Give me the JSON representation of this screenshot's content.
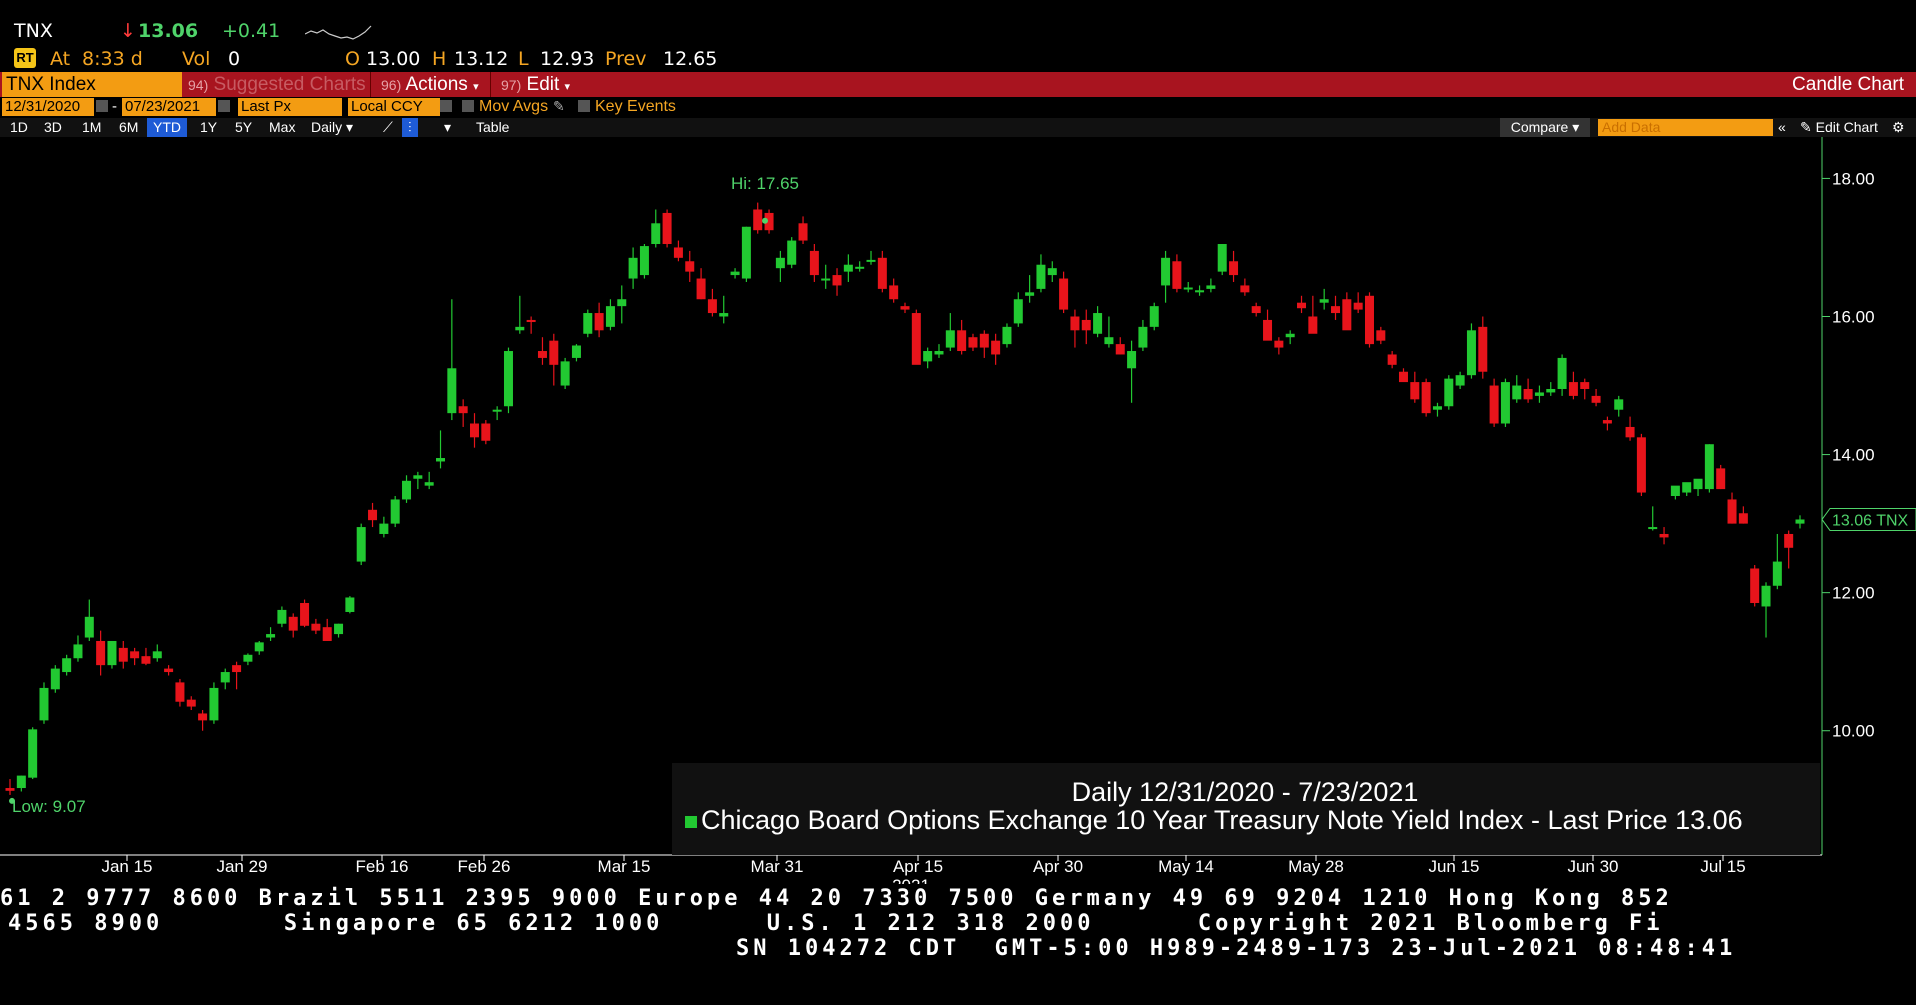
{
  "quote": {
    "ticker": "TNX",
    "arrow": "↓",
    "last": "13.06",
    "change": "+0.41",
    "at_label": "At",
    "time": "8:33 d",
    "vol_label": "Vol",
    "vol": "0",
    "open_label": "O",
    "open": "13.00",
    "high_label": "H",
    "high": "13.12",
    "low_label": "L",
    "low": "12.93",
    "prev_label": "Prev",
    "prev": "12.65"
  },
  "toolbar": {
    "security": "TNX Index",
    "suggest_num": "94)",
    "suggest_label": "Suggested Charts",
    "actions_num": "96)",
    "actions_label": "Actions",
    "edit_num": "97)",
    "edit_label": "Edit",
    "chart_type": "Candle Chart"
  },
  "fields": {
    "start_date": "12/31/2020",
    "dash": "-",
    "end_date": "07/23/2021",
    "price_field": "Last Px",
    "currency": "Local CCY",
    "mov_avgs": "Mov Avgs",
    "key_events": "Key Events"
  },
  "periods": [
    "1D",
    "3D",
    "1M",
    "6M",
    "YTD",
    "1Y",
    "5Y",
    "Max"
  ],
  "selected_period": "YTD",
  "frequency": "Daily",
  "table_label": "Table",
  "compare_label": "Compare",
  "add_data_placeholder": "Add Data",
  "edit_chart_label": "Edit Chart",
  "colors": {
    "up": "#22c932",
    "down": "#e8141b",
    "axis": "#4fd36a",
    "accent": "#f39c12",
    "toolbar": "#a8141f"
  },
  "chart_data": {
    "type": "candlestick",
    "ylim": [
      8.2,
      18.6
    ],
    "yticks": [
      "18.00",
      "16.00",
      "14.00",
      "12.00",
      "10.00"
    ],
    "xticks": [
      "Jan 15",
      "Jan 29",
      "Feb 16",
      "Feb 26",
      "Mar 15",
      "Mar 31",
      "Apr 15",
      "Apr 30",
      "May 14",
      "May 28",
      "Jun 15",
      "Jun 30",
      "Jul 15"
    ],
    "year_label": "2021",
    "hi_label": "Hi: 17.65",
    "low_label": "Low: 9.07",
    "last_label": "13.06 TNX",
    "legend_title": "Daily 12/31/2020 - 7/23/2021",
    "legend_series": "Chicago Board Options Exchange 10 Year Treasury Note Yield Index - Last Price 13.06",
    "candles": [
      [
        9.17,
        9.3,
        9.07,
        9.13
      ],
      [
        9.17,
        9.35,
        9.12,
        9.35
      ],
      [
        9.32,
        10.05,
        9.3,
        10.02
      ],
      [
        10.15,
        10.7,
        10.1,
        10.62
      ],
      [
        10.6,
        10.95,
        10.55,
        10.9
      ],
      [
        10.85,
        11.1,
        10.8,
        11.05
      ],
      [
        11.05,
        11.38,
        11.0,
        11.25
      ],
      [
        11.35,
        11.9,
        11.3,
        11.65
      ],
      [
        11.3,
        11.45,
        10.8,
        10.95
      ],
      [
        10.95,
        11.3,
        10.9,
        11.3
      ],
      [
        11.2,
        11.3,
        10.9,
        11.0
      ],
      [
        11.15,
        11.2,
        10.95,
        11.05
      ],
      [
        11.08,
        11.2,
        10.95,
        10.97
      ],
      [
        11.05,
        11.25,
        11.0,
        11.15
      ],
      [
        10.9,
        10.95,
        10.8,
        10.85
      ],
      [
        10.7,
        10.75,
        10.35,
        10.42
      ],
      [
        10.45,
        10.5,
        10.3,
        10.35
      ],
      [
        10.25,
        10.3,
        10.0,
        10.15
      ],
      [
        10.15,
        10.7,
        10.1,
        10.62
      ],
      [
        10.7,
        10.9,
        10.6,
        10.85
      ],
      [
        10.95,
        11.0,
        10.6,
        10.85
      ],
      [
        11.0,
        11.12,
        10.95,
        11.1
      ],
      [
        11.15,
        11.3,
        11.1,
        11.28
      ],
      [
        11.35,
        11.5,
        11.3,
        11.4
      ],
      [
        11.55,
        11.8,
        11.5,
        11.75
      ],
      [
        11.65,
        11.7,
        11.35,
        11.45
      ],
      [
        11.85,
        11.9,
        11.5,
        11.52
      ],
      [
        11.55,
        11.62,
        11.4,
        11.45
      ],
      [
        11.5,
        11.62,
        11.3,
        11.3
      ],
      [
        11.4,
        11.55,
        11.35,
        11.55
      ],
      [
        11.72,
        11.95,
        11.7,
        11.93
      ],
      [
        12.45,
        13.0,
        12.4,
        12.95
      ],
      [
        13.2,
        13.3,
        12.95,
        13.05
      ],
      [
        12.85,
        13.1,
        12.8,
        13.0
      ],
      [
        13.0,
        13.4,
        12.95,
        13.35
      ],
      [
        13.35,
        13.7,
        13.3,
        13.62
      ],
      [
        13.65,
        13.75,
        13.5,
        13.7
      ],
      [
        13.55,
        13.75,
        13.5,
        13.6
      ],
      [
        13.9,
        14.35,
        13.8,
        13.95
      ],
      [
        14.6,
        16.25,
        14.5,
        15.25
      ],
      [
        14.7,
        14.8,
        14.4,
        14.6
      ],
      [
        14.45,
        14.6,
        14.1,
        14.25
      ],
      [
        14.45,
        14.5,
        14.15,
        14.2
      ],
      [
        14.65,
        14.7,
        14.5,
        14.65
      ],
      [
        14.7,
        15.55,
        14.6,
        15.5
      ],
      [
        15.8,
        16.3,
        15.75,
        15.85
      ],
      [
        15.95,
        16.0,
        15.75,
        15.92
      ],
      [
        15.5,
        15.7,
        15.3,
        15.4
      ],
      [
        15.65,
        15.75,
        15.0,
        15.3
      ],
      [
        15.0,
        15.4,
        14.95,
        15.35
      ],
      [
        15.4,
        15.6,
        15.35,
        15.58
      ],
      [
        15.75,
        16.1,
        15.7,
        16.05
      ],
      [
        16.05,
        16.2,
        15.7,
        15.8
      ],
      [
        15.85,
        16.25,
        15.8,
        16.15
      ],
      [
        16.15,
        16.45,
        15.9,
        16.25
      ],
      [
        16.55,
        17.0,
        16.4,
        16.85
      ],
      [
        16.6,
        17.05,
        16.55,
        17.02
      ],
      [
        17.05,
        17.55,
        17.0,
        17.35
      ],
      [
        17.5,
        17.55,
        17.0,
        17.05
      ],
      [
        17.0,
        17.1,
        16.8,
        16.85
      ],
      [
        16.8,
        16.95,
        16.5,
        16.65
      ],
      [
        16.55,
        16.7,
        16.25,
        16.25
      ],
      [
        16.25,
        16.4,
        16.0,
        16.05
      ],
      [
        16.0,
        16.3,
        15.9,
        16.05
      ],
      [
        16.6,
        16.7,
        16.55,
        16.65
      ],
      [
        16.55,
        17.3,
        16.5,
        17.3
      ],
      [
        17.55,
        17.65,
        17.2,
        17.25
      ],
      [
        17.5,
        17.55,
        17.2,
        17.25
      ],
      [
        16.7,
        16.95,
        16.5,
        16.85
      ],
      [
        16.75,
        17.15,
        16.7,
        17.1
      ],
      [
        17.35,
        17.45,
        17.05,
        17.1
      ],
      [
        16.95,
        17.05,
        16.5,
        16.6
      ],
      [
        16.55,
        16.75,
        16.4,
        16.55
      ],
      [
        16.6,
        16.7,
        16.3,
        16.45
      ],
      [
        16.65,
        16.9,
        16.5,
        16.75
      ],
      [
        16.7,
        16.8,
        16.65,
        16.72
      ],
      [
        16.8,
        16.95,
        16.75,
        16.82
      ],
      [
        16.85,
        16.95,
        16.35,
        16.4
      ],
      [
        16.45,
        16.55,
        16.2,
        16.25
      ],
      [
        16.15,
        16.2,
        16.05,
        16.1
      ],
      [
        16.05,
        16.1,
        15.4,
        15.3
      ],
      [
        15.35,
        15.55,
        15.25,
        15.5
      ],
      [
        15.45,
        15.6,
        15.4,
        15.5
      ],
      [
        15.55,
        16.05,
        15.5,
        15.8
      ],
      [
        15.8,
        15.95,
        15.45,
        15.5
      ],
      [
        15.7,
        15.75,
        15.5,
        15.55
      ],
      [
        15.75,
        15.8,
        15.4,
        15.55
      ],
      [
        15.65,
        15.75,
        15.3,
        15.45
      ],
      [
        15.6,
        15.9,
        15.55,
        15.85
      ],
      [
        15.9,
        16.35,
        15.85,
        16.25
      ],
      [
        16.3,
        16.6,
        16.2,
        16.35
      ],
      [
        16.4,
        16.9,
        16.35,
        16.75
      ],
      [
        16.6,
        16.8,
        16.5,
        16.7
      ],
      [
        16.55,
        16.65,
        16.05,
        16.1
      ],
      [
        16.0,
        16.1,
        15.55,
        15.8
      ],
      [
        15.95,
        16.1,
        15.6,
        15.8
      ],
      [
        15.75,
        16.15,
        15.7,
        16.05
      ],
      [
        15.6,
        16.0,
        15.55,
        15.7
      ],
      [
        15.6,
        15.7,
        15.45,
        15.45
      ],
      [
        15.25,
        15.65,
        14.75,
        15.5
      ],
      [
        15.55,
        15.95,
        15.5,
        15.85
      ],
      [
        15.85,
        16.2,
        15.8,
        16.15
      ],
      [
        16.45,
        16.95,
        16.2,
        16.85
      ],
      [
        16.8,
        16.9,
        16.35,
        16.4
      ],
      [
        16.4,
        16.5,
        16.35,
        16.42
      ],
      [
        16.35,
        16.45,
        16.3,
        16.38
      ],
      [
        16.4,
        16.55,
        16.35,
        16.45
      ],
      [
        16.65,
        17.05,
        16.6,
        17.05
      ],
      [
        16.8,
        16.95,
        16.5,
        16.6
      ],
      [
        16.45,
        16.55,
        16.3,
        16.35
      ],
      [
        16.15,
        16.2,
        16.0,
        16.05
      ],
      [
        15.95,
        16.1,
        15.7,
        15.65
      ],
      [
        15.65,
        15.7,
        15.45,
        15.55
      ],
      [
        15.7,
        15.8,
        15.6,
        15.75
      ],
      [
        16.2,
        16.3,
        16.05,
        16.12
      ],
      [
        16.0,
        16.3,
        15.85,
        15.75
      ],
      [
        16.2,
        16.4,
        16.1,
        16.25
      ],
      [
        16.15,
        16.3,
        15.95,
        16.05
      ],
      [
        16.25,
        16.35,
        15.9,
        15.8
      ],
      [
        16.2,
        16.35,
        16.05,
        16.1
      ],
      [
        16.3,
        16.35,
        15.55,
        15.6
      ],
      [
        15.8,
        15.85,
        15.6,
        15.65
      ],
      [
        15.45,
        15.5,
        15.25,
        15.3
      ],
      [
        15.2,
        15.25,
        15.1,
        15.05
      ],
      [
        15.05,
        15.2,
        14.75,
        14.8
      ],
      [
        15.05,
        15.1,
        14.55,
        14.6
      ],
      [
        14.65,
        14.75,
        14.55,
        14.7
      ],
      [
        14.7,
        15.15,
        14.65,
        15.1
      ],
      [
        15.0,
        15.2,
        14.95,
        15.15
      ],
      [
        15.15,
        15.9,
        15.1,
        15.8
      ],
      [
        15.85,
        16.0,
        15.1,
        15.2
      ],
      [
        15.0,
        15.1,
        14.4,
        14.45
      ],
      [
        14.45,
        15.1,
        14.4,
        15.05
      ],
      [
        14.8,
        15.15,
        14.75,
        15.0
      ],
      [
        14.95,
        15.1,
        14.75,
        14.8
      ],
      [
        14.85,
        15.0,
        14.75,
        14.9
      ],
      [
        14.9,
        15.05,
        14.85,
        14.95
      ],
      [
        14.95,
        15.45,
        14.85,
        15.4
      ],
      [
        15.05,
        15.2,
        14.8,
        14.85
      ],
      [
        15.05,
        15.1,
        14.8,
        14.95
      ],
      [
        14.85,
        14.95,
        14.7,
        14.75
      ],
      [
        14.5,
        14.55,
        14.35,
        14.45
      ],
      [
        14.65,
        14.85,
        14.55,
        14.8
      ],
      [
        14.4,
        14.55,
        14.2,
        14.25
      ],
      [
        14.25,
        14.3,
        13.4,
        13.45
      ],
      [
        12.95,
        13.25,
        12.9,
        12.95
      ],
      [
        12.85,
        12.95,
        12.7,
        12.8
      ],
      [
        13.4,
        13.5,
        13.35,
        13.55
      ],
      [
        13.45,
        13.55,
        13.4,
        13.6
      ],
      [
        13.5,
        13.55,
        13.4,
        13.65
      ],
      [
        13.5,
        14.15,
        13.45,
        14.15
      ],
      [
        13.8,
        13.85,
        13.5,
        13.5
      ],
      [
        13.35,
        13.45,
        13.0,
        13.0
      ],
      [
        13.15,
        13.25,
        13.0,
        13.0
      ],
      [
        12.35,
        12.4,
        11.8,
        11.85
      ],
      [
        11.8,
        12.15,
        11.35,
        12.1
      ],
      [
        12.1,
        12.85,
        12.05,
        12.45
      ],
      [
        12.85,
        12.9,
        12.35,
        12.65
      ],
      [
        13.0,
        13.12,
        12.93,
        13.06
      ]
    ]
  },
  "bottom_lines": [
    "61 2 9777 8600 Brazil 5511 2395 9000 Europe 44 20 7330 7500 Germany 49 69 9204 1210 Hong Kong 852",
    "4565 8900       Singapore 65 6212 1000      U.S. 1 212 318 2000      Copyright 2021 Bloomberg Fi",
    "SN 104272 CDT  GMT-5:00 H989-2489-173 23-Jul-2021 08:48:41"
  ]
}
